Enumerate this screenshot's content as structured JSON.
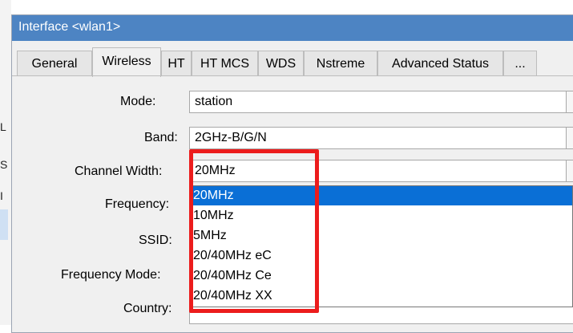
{
  "window": {
    "title": "Interface <wlan1>"
  },
  "tabs": [
    {
      "label": "General"
    },
    {
      "label": "Wireless"
    },
    {
      "label": "HT"
    },
    {
      "label": "HT MCS"
    },
    {
      "label": "WDS"
    },
    {
      "label": "Nstreme"
    },
    {
      "label": "Advanced Status"
    },
    {
      "label": "..."
    }
  ],
  "form": {
    "mode": {
      "label": "Mode:",
      "value": "station"
    },
    "band": {
      "label": "Band:",
      "value": "2GHz-B/G/N"
    },
    "channel_width": {
      "label": "Channel Width:",
      "value": "20MHz"
    },
    "frequency": {
      "label": "Frequency:"
    },
    "ssid": {
      "label": "SSID:"
    },
    "frequency_mode": {
      "label": "Frequency Mode:"
    },
    "country": {
      "label": "Country:"
    }
  },
  "dropdown": {
    "options": [
      "20MHz",
      "10MHz",
      "5MHz",
      "20/40MHz eC",
      "20/40MHz Ce",
      "20/40MHz XX"
    ],
    "selected": "20MHz"
  },
  "background_marks": [
    "L",
    "S",
    "I"
  ],
  "colors": {
    "titlebar": "#4d84c3",
    "selection": "#0a6fd6",
    "highlight_box": "#ec1c1c"
  }
}
